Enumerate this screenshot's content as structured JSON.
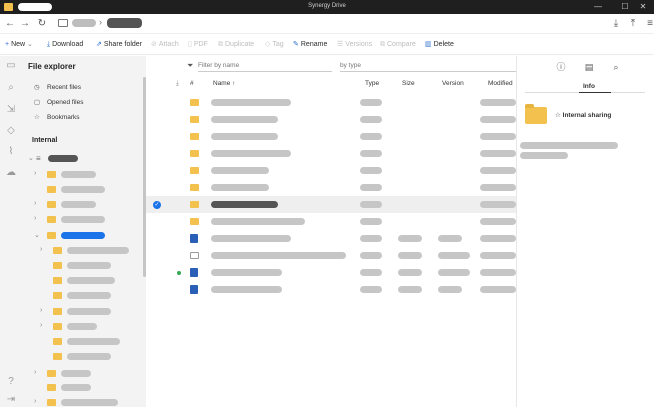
{
  "window": {
    "title": "Synergy Drive"
  },
  "titlebar": {
    "min": "—",
    "max": "☐",
    "close": "✕"
  },
  "nav": {
    "back": "←",
    "forward": "→",
    "refresh": "↻",
    "breadcrumb_sep": "›",
    "download": "⤓",
    "upload": "⤒",
    "menu": "≡"
  },
  "toolbar": {
    "new": "New",
    "download": "Download",
    "share_folder": "Share folder",
    "attach": "Attach",
    "pdf": "PDF",
    "duplicate": "Duplicate",
    "tag": "Tag",
    "rename": "Rename",
    "versions": "Versions",
    "compare": "Compare",
    "delete": "Delete"
  },
  "sidebar": {
    "title": "File explorer",
    "recent": "Recent files",
    "opened": "Opened files",
    "bookmarks": "Bookmarks",
    "section": "Internal"
  },
  "filter": {
    "name_placeholder": "Filter by name",
    "type_placeholder": "by type"
  },
  "table": {
    "headers": {
      "hash": "#",
      "name": "Name",
      "sort": "↑",
      "type": "Type",
      "size": "Size",
      "version": "Version",
      "modified": "Modified"
    }
  },
  "info": {
    "tab_label": "Info",
    "internal_sharing": "Internal sharing"
  },
  "colors": {
    "accent": "#1a73e8",
    "folder": "#f2c14e",
    "titlebar": "#1f1f1f"
  }
}
